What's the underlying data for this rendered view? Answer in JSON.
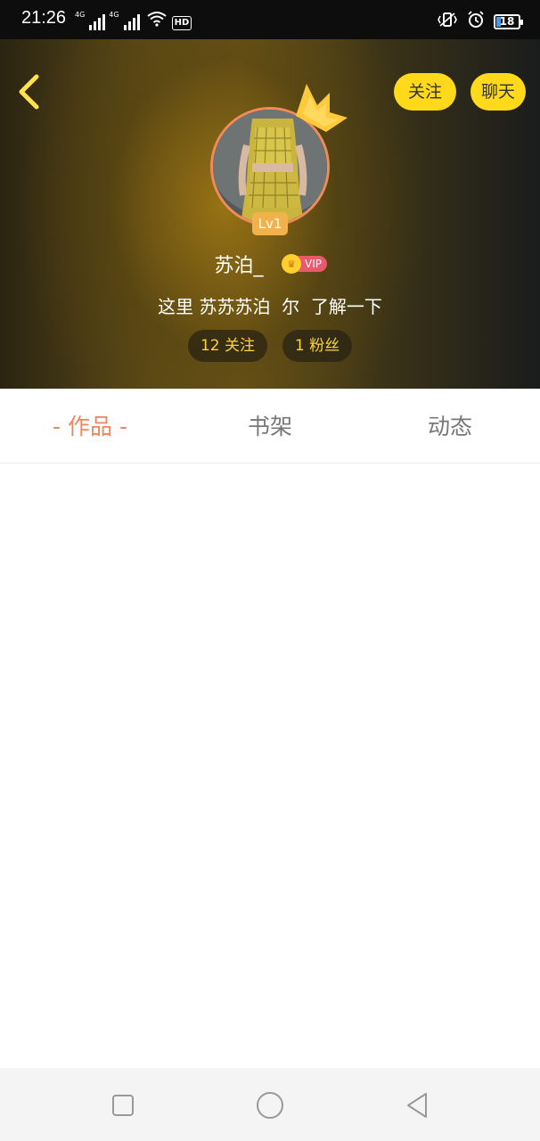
{
  "status_bar": {
    "time": "21:26",
    "net1": "4G",
    "net2": "4G",
    "hd": "HD",
    "battery": "18"
  },
  "header": {
    "follow_label": "关注",
    "chat_label": "聊天"
  },
  "profile": {
    "level": "Lv1",
    "username": "苏泊_",
    "vip_label": "VIP",
    "bio": "这里 苏苏苏泊  尔  了解一下",
    "following": "12 关注",
    "fans": "1 粉丝"
  },
  "tabs": [
    {
      "label": "- 作品 -",
      "active": true
    },
    {
      "label": "书架",
      "active": false
    },
    {
      "label": "动态",
      "active": false
    }
  ],
  "colors": {
    "accent_orange": "#f0845a",
    "button_yellow": "#ffd91a",
    "stat_text": "#ffd23a",
    "vip_red": "#e85a6b"
  }
}
